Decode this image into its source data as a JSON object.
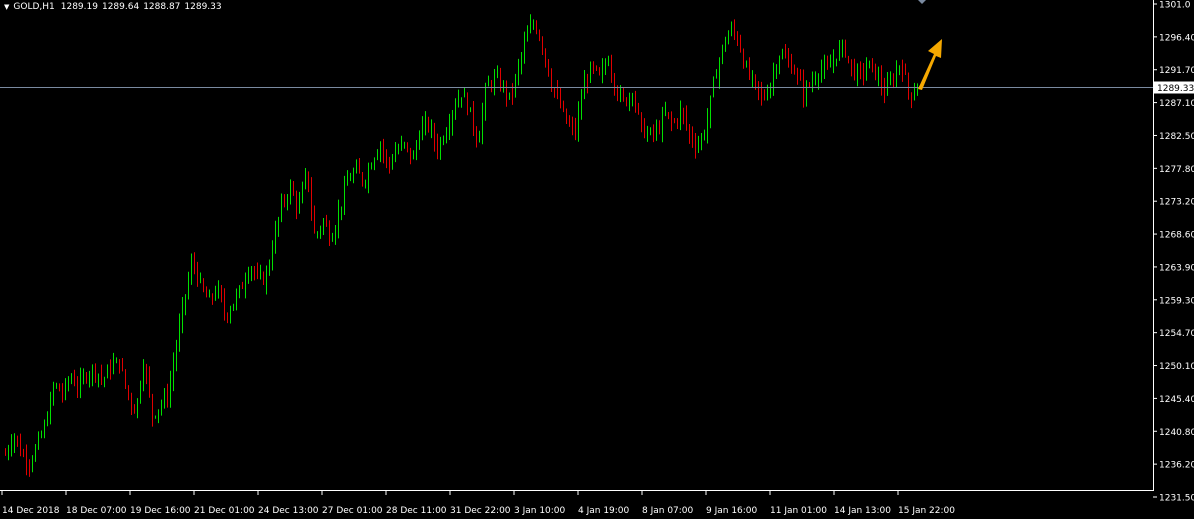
{
  "header": {
    "symbol": "GOLD,H1",
    "open": "1289.19",
    "high": "1289.64",
    "low": "1288.87",
    "close": "1289.33"
  },
  "chart_data": {
    "type": "candlestick",
    "symbol": "GOLD",
    "timeframe": "H1",
    "current_price": 1289.33,
    "y_ticks": [
      "1301.0",
      "1296.40",
      "1291.70",
      "1287.10",
      "1282.50",
      "1277.80",
      "1273.20",
      "1268.60",
      "1263.90",
      "1259.30",
      "1254.70",
      "1250.10",
      "1245.40",
      "1240.80",
      "1236.20",
      "1231.50"
    ],
    "ylim": [
      1231.5,
      1301.0
    ],
    "x_ticks": [
      "14 Dec 2018",
      "18 Dec 07:00",
      "19 Dec 16:00",
      "21 Dec 01:00",
      "24 Dec 13:00",
      "27 Dec 01:00",
      "28 Dec 11:00",
      "31 Dec 22:00",
      "3 Jan 10:00",
      "4 Jan 19:00",
      "8 Jan 07:00",
      "9 Jan 16:00",
      "11 Jan 01:00",
      "14 Jan 13:00",
      "15 Jan 22:00"
    ],
    "close_path": [
      1237.5,
      1240.5,
      1237.5,
      1236.5,
      1239,
      1242,
      1247.5,
      1246,
      1248.5,
      1247,
      1249,
      1249.5,
      1248,
      1250,
      1250.5,
      1246,
      1243.5,
      1251,
      1243,
      1244.5,
      1246,
      1253,
      1259.5,
      1265,
      1261,
      1259,
      1261,
      1257,
      1259,
      1261,
      1264.5,
      1262,
      1262.5,
      1268,
      1273,
      1275,
      1272,
      1277.5,
      1268,
      1270.5,
      1268,
      1272,
      1276,
      1277.5,
      1276,
      1279,
      1281.5,
      1278,
      1280.5,
      1281,
      1279,
      1283.5,
      1284,
      1280.5,
      1283,
      1286.5,
      1288.5,
      1286,
      1281.5,
      1289,
      1290.5,
      1289.5,
      1287.5,
      1292,
      1296.5,
      1298.5,
      1295,
      1290,
      1287,
      1284,
      1283,
      1289.5,
      1292,
      1290.5,
      1293.5,
      1289,
      1287,
      1289,
      1283.5,
      1282.5,
      1283,
      1285.5,
      1284,
      1286,
      1282.5,
      1281,
      1283.5,
      1290,
      1294.5,
      1297.5,
      1296,
      1291.5,
      1289.5,
      1287.5,
      1290,
      1294,
      1293,
      1291.5,
      1288.5,
      1290,
      1292,
      1291.5,
      1294,
      1295,
      1291.5,
      1291,
      1292.5,
      1291,
      1288.5,
      1290.5,
      1293,
      1288,
      1289.33
    ]
  },
  "annotation": {
    "arrow_color": "#f5a800",
    "price_line_color": "#7a8aa0"
  }
}
